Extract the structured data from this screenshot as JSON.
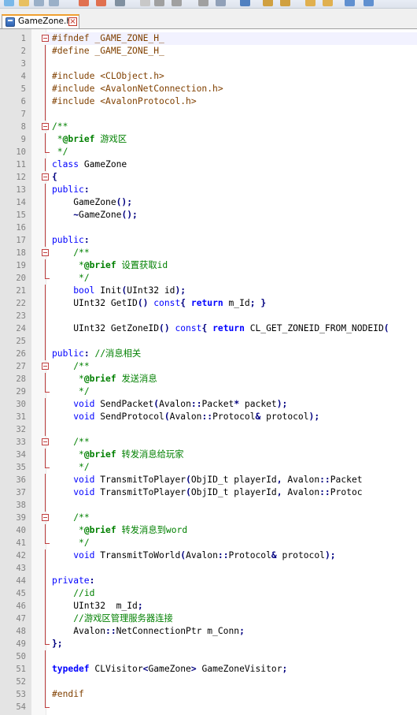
{
  "tab": {
    "label": "GameZone.h"
  },
  "colors": {
    "comment": "#008000",
    "keyword": "#0000ff",
    "preprocessor": "#804000",
    "operator": "#000080",
    "line_number": "#808080",
    "fold_marker": "#c04040",
    "tab_accent": "#f0a030"
  },
  "fold_markers": {
    "1": "open",
    "8": "open",
    "10": "end",
    "12": "open",
    "18": "open",
    "20": "end",
    "27": "open",
    "29": "end",
    "33": "open",
    "35": "end",
    "39": "open",
    "41": "end",
    "49": "end",
    "54": "end"
  },
  "lines": [
    [
      [
        "pp",
        "#ifndef _GAME_ZONE_H_"
      ]
    ],
    [
      [
        "pp",
        "#define _GAME_ZONE_H_"
      ]
    ],
    [],
    [
      [
        "pp",
        "#include <CLObject.h>"
      ]
    ],
    [
      [
        "pp",
        "#include <AvalonNetConnection.h>"
      ]
    ],
    [
      [
        "pp",
        "#include <AvalonProtocol.h>"
      ]
    ],
    [],
    [
      [
        "c",
        "/**"
      ]
    ],
    [
      [
        "c",
        " *"
      ],
      [
        "dk",
        "@brief"
      ],
      [
        "c",
        " 游戏区"
      ]
    ],
    [
      [
        "c",
        " */"
      ]
    ],
    [
      [
        "kw",
        "class"
      ],
      [
        "t",
        " GameZone"
      ]
    ],
    [
      [
        "op",
        "{"
      ]
    ],
    [
      [
        "kw",
        "public"
      ],
      [
        "op",
        ":"
      ]
    ],
    [
      [
        "t",
        "    GameZone"
      ],
      [
        "op",
        "();"
      ]
    ],
    [
      [
        "t",
        "    "
      ],
      [
        "op",
        "~"
      ],
      [
        "t",
        "GameZone"
      ],
      [
        "op",
        "();"
      ]
    ],
    [],
    [
      [
        "kw",
        "public"
      ],
      [
        "op",
        ":"
      ]
    ],
    [
      [
        "t",
        "    "
      ],
      [
        "c",
        "/**"
      ]
    ],
    [
      [
        "t",
        "    "
      ],
      [
        "c",
        " *"
      ],
      [
        "dk",
        "@brief"
      ],
      [
        "c",
        " 设置获取id"
      ]
    ],
    [
      [
        "t",
        "    "
      ],
      [
        "c",
        " */"
      ]
    ],
    [
      [
        "t",
        "    "
      ],
      [
        "kw",
        "bool"
      ],
      [
        "t",
        " Init"
      ],
      [
        "op",
        "("
      ],
      [
        "t",
        "UInt32 id"
      ],
      [
        "op",
        ");"
      ]
    ],
    [
      [
        "t",
        "    UInt32 GetID"
      ],
      [
        "op",
        "()"
      ],
      [
        "t",
        " "
      ],
      [
        "kw",
        "const"
      ],
      [
        "op",
        "{"
      ],
      [
        "t",
        " "
      ],
      [
        "kwb",
        "return"
      ],
      [
        "t",
        " m_Id"
      ],
      [
        "op",
        ";"
      ],
      [
        "t",
        " "
      ],
      [
        "op",
        "}"
      ]
    ],
    [],
    [
      [
        "t",
        "    UInt32 GetZoneID"
      ],
      [
        "op",
        "()"
      ],
      [
        "t",
        " "
      ],
      [
        "kw",
        "const"
      ],
      [
        "op",
        "{"
      ],
      [
        "t",
        " "
      ],
      [
        "kwb",
        "return"
      ],
      [
        "t",
        " CL_GET_ZONEID_FROM_NODEID"
      ],
      [
        "op",
        "("
      ]
    ],
    [],
    [
      [
        "kw",
        "public"
      ],
      [
        "op",
        ":"
      ],
      [
        "t",
        " "
      ],
      [
        "c",
        "//消息相关"
      ]
    ],
    [
      [
        "t",
        "    "
      ],
      [
        "c",
        "/**"
      ]
    ],
    [
      [
        "t",
        "    "
      ],
      [
        "c",
        " *"
      ],
      [
        "dk",
        "@brief"
      ],
      [
        "c",
        " 发送消息"
      ]
    ],
    [
      [
        "t",
        "    "
      ],
      [
        "c",
        " */"
      ]
    ],
    [
      [
        "t",
        "    "
      ],
      [
        "kw",
        "void"
      ],
      [
        "t",
        " SendPacket"
      ],
      [
        "op",
        "("
      ],
      [
        "t",
        "Avalon"
      ],
      [
        "op",
        "::"
      ],
      [
        "t",
        "Packet"
      ],
      [
        "op",
        "*"
      ],
      [
        "t",
        " packet"
      ],
      [
        "op",
        ");"
      ]
    ],
    [
      [
        "t",
        "    "
      ],
      [
        "kw",
        "void"
      ],
      [
        "t",
        " SendProtocol"
      ],
      [
        "op",
        "("
      ],
      [
        "t",
        "Avalon"
      ],
      [
        "op",
        "::"
      ],
      [
        "t",
        "Protocol"
      ],
      [
        "op",
        "&"
      ],
      [
        "t",
        " protocol"
      ],
      [
        "op",
        ");"
      ]
    ],
    [],
    [
      [
        "t",
        "    "
      ],
      [
        "c",
        "/**"
      ]
    ],
    [
      [
        "t",
        "    "
      ],
      [
        "c",
        " *"
      ],
      [
        "dk",
        "@brief"
      ],
      [
        "c",
        " 转发消息给玩家"
      ]
    ],
    [
      [
        "t",
        "    "
      ],
      [
        "c",
        " */"
      ]
    ],
    [
      [
        "t",
        "    "
      ],
      [
        "kw",
        "void"
      ],
      [
        "t",
        " TransmitToPlayer"
      ],
      [
        "op",
        "("
      ],
      [
        "t",
        "ObjID_t playerId"
      ],
      [
        "op",
        ","
      ],
      [
        "t",
        " Avalon"
      ],
      [
        "op",
        "::"
      ],
      [
        "t",
        "Packet"
      ]
    ],
    [
      [
        "t",
        "    "
      ],
      [
        "kw",
        "void"
      ],
      [
        "t",
        " TransmitToPlayer"
      ],
      [
        "op",
        "("
      ],
      [
        "t",
        "ObjID_t playerId"
      ],
      [
        "op",
        ","
      ],
      [
        "t",
        " Avalon"
      ],
      [
        "op",
        "::"
      ],
      [
        "t",
        "Protoc"
      ]
    ],
    [],
    [
      [
        "t",
        "    "
      ],
      [
        "c",
        "/**"
      ]
    ],
    [
      [
        "t",
        "    "
      ],
      [
        "c",
        " *"
      ],
      [
        "dk",
        "@brief"
      ],
      [
        "c",
        " 转发消息到word"
      ]
    ],
    [
      [
        "t",
        "    "
      ],
      [
        "c",
        " */"
      ]
    ],
    [
      [
        "t",
        "    "
      ],
      [
        "kw",
        "void"
      ],
      [
        "t",
        " TransmitToWorld"
      ],
      [
        "op",
        "("
      ],
      [
        "t",
        "Avalon"
      ],
      [
        "op",
        "::"
      ],
      [
        "t",
        "Protocol"
      ],
      [
        "op",
        "&"
      ],
      [
        "t",
        " protocol"
      ],
      [
        "op",
        ");"
      ]
    ],
    [],
    [
      [
        "kw",
        "private"
      ],
      [
        "op",
        ":"
      ]
    ],
    [
      [
        "t",
        "    "
      ],
      [
        "c",
        "//id"
      ]
    ],
    [
      [
        "t",
        "    UInt32  m_Id"
      ],
      [
        "op",
        ";"
      ]
    ],
    [
      [
        "t",
        "    "
      ],
      [
        "c",
        "//游戏区管理服务器连接"
      ]
    ],
    [
      [
        "t",
        "    Avalon"
      ],
      [
        "op",
        "::"
      ],
      [
        "t",
        "NetConnectionPtr m_Conn"
      ],
      [
        "op",
        ";"
      ]
    ],
    [
      [
        "op",
        "};"
      ]
    ],
    [],
    [
      [
        "kwb",
        "typedef"
      ],
      [
        "t",
        " CLVisitor"
      ],
      [
        "op",
        "<"
      ],
      [
        "t",
        "GameZone"
      ],
      [
        "op",
        ">"
      ],
      [
        "t",
        " GameZoneVisitor"
      ],
      [
        "op",
        ";"
      ]
    ],
    [],
    [
      [
        "pp",
        "#endif"
      ]
    ],
    []
  ]
}
